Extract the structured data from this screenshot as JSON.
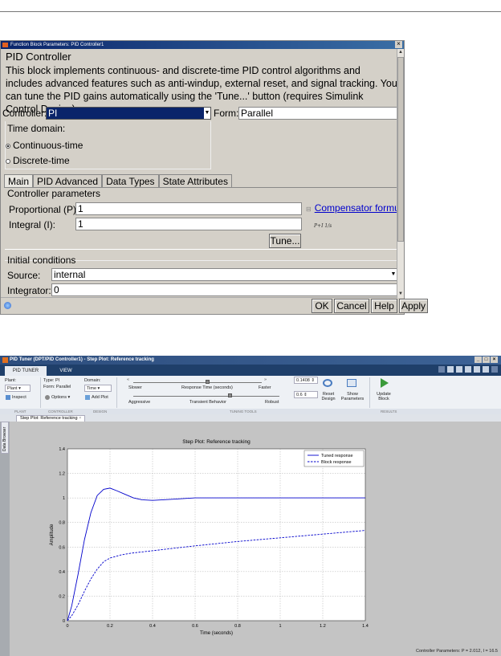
{
  "dialog": {
    "title": "Function Block Parameters: PID Controller1",
    "close_glyph": "×",
    "block_name": "PID Controller",
    "description": "This block implements continuous- and discrete-time PID control algorithms and includes advanced features such as anti-windup, external reset, and signal tracking. You can tune the PID gains automatically using the 'Tune...' button (requires Simulink Control Design).",
    "controller_label": "Controller:",
    "controller_value": "PI",
    "form_label": "Form:",
    "form_value": "Parallel",
    "time_domain_label": "Time domain:",
    "continuous_label": "Continuous-time",
    "discrete_label": "Discrete-time",
    "tabs": [
      "Main",
      "PID Advanced",
      "Data Types",
      "State Attributes"
    ],
    "controller_params_label": "Controller parameters",
    "p_label": "Proportional (P):",
    "p_value": "1",
    "i_label": "Integral (I):",
    "i_value": "1",
    "compensator_label": "Compensator formula",
    "formula_text": "P+I 1/s",
    "tune_label": "Tune...",
    "initial_conditions_label": "Initial conditions",
    "source_label": "Source:",
    "source_value": "internal",
    "integrator_label": "Integrator:",
    "integrator_value": "0",
    "buttons": {
      "ok": "OK",
      "cancel": "Cancel",
      "help": "Help",
      "apply": "Apply"
    }
  },
  "tuner": {
    "title": "PID Tuner (DPT/PID Controller1) - Step Plot: Reference tracking",
    "tabs": [
      "PID TUNER",
      "VIEW"
    ],
    "plant_label": "Plant:",
    "plant_value": "Plant",
    "type_label": "Type: PI",
    "form_label": "Form: Parallel",
    "domain_label": "Domain:",
    "domain_value": "Time",
    "inspect_label": "Inspect",
    "options_label": "Options",
    "add_plot_label": "Add Plot",
    "slower_label": "Slower",
    "faster_label": "Faster",
    "response_time_label": "Response Time (seconds)",
    "aggressive_label": "Aggressive",
    "robust_label": "Robust",
    "transient_label": "Transient Behavior",
    "response_time_value": "0.1408",
    "transient_value": "0.6",
    "reset_design_label": "Reset Design",
    "show_params_label": "Show Parameters",
    "update_block_label": "Update Block",
    "sections": [
      "PLANT",
      "CONTROLLER",
      "DESIGN",
      "TUNING TOOLS",
      "RESULTS"
    ],
    "doc_tab_label": "Step Plot: Reference tracking",
    "side_tab_label": "Data Browser",
    "controller_params_text": "Controller Parameters: P = 2.012, I = 16.5"
  },
  "chart_data": {
    "type": "line",
    "title": "Step Plot: Reference tracking",
    "xlabel": "Time (seconds)",
    "ylabel": "Amplitude",
    "xlim": [
      0,
      1.4
    ],
    "ylim": [
      0,
      1.4
    ],
    "xticks": [
      "0",
      "0.2",
      "0.4",
      "0.6",
      "0.8",
      "1",
      "1.2",
      "1.4"
    ],
    "yticks": [
      "0",
      "0.2",
      "0.4",
      "0.6",
      "0.8",
      "1",
      "1.2",
      "1.4"
    ],
    "grid": true,
    "legend_position": "top-right",
    "series": [
      {
        "name": "Tuned response",
        "style": "solid",
        "color": "#0000cc",
        "x": [
          0,
          0.02,
          0.05,
          0.08,
          0.11,
          0.14,
          0.17,
          0.2,
          0.23,
          0.27,
          0.31,
          0.35,
          0.4,
          0.45,
          0.5,
          0.6,
          0.8,
          1.0,
          1.2,
          1.4
        ],
        "y": [
          0,
          0.12,
          0.38,
          0.66,
          0.88,
          1.02,
          1.07,
          1.08,
          1.06,
          1.03,
          1.0,
          0.985,
          0.98,
          0.985,
          0.99,
          1.0,
          1.0,
          1.0,
          1.0,
          1.0
        ]
      },
      {
        "name": "Block response",
        "style": "dashed",
        "color": "#0000cc",
        "x": [
          0,
          0.02,
          0.05,
          0.08,
          0.11,
          0.14,
          0.17,
          0.2,
          0.25,
          0.3,
          0.4,
          0.5,
          0.6,
          0.8,
          1.0,
          1.2,
          1.4
        ],
        "y": [
          0,
          0.04,
          0.13,
          0.24,
          0.34,
          0.42,
          0.48,
          0.51,
          0.535,
          0.55,
          0.57,
          0.59,
          0.61,
          0.645,
          0.675,
          0.705,
          0.735
        ]
      }
    ]
  }
}
